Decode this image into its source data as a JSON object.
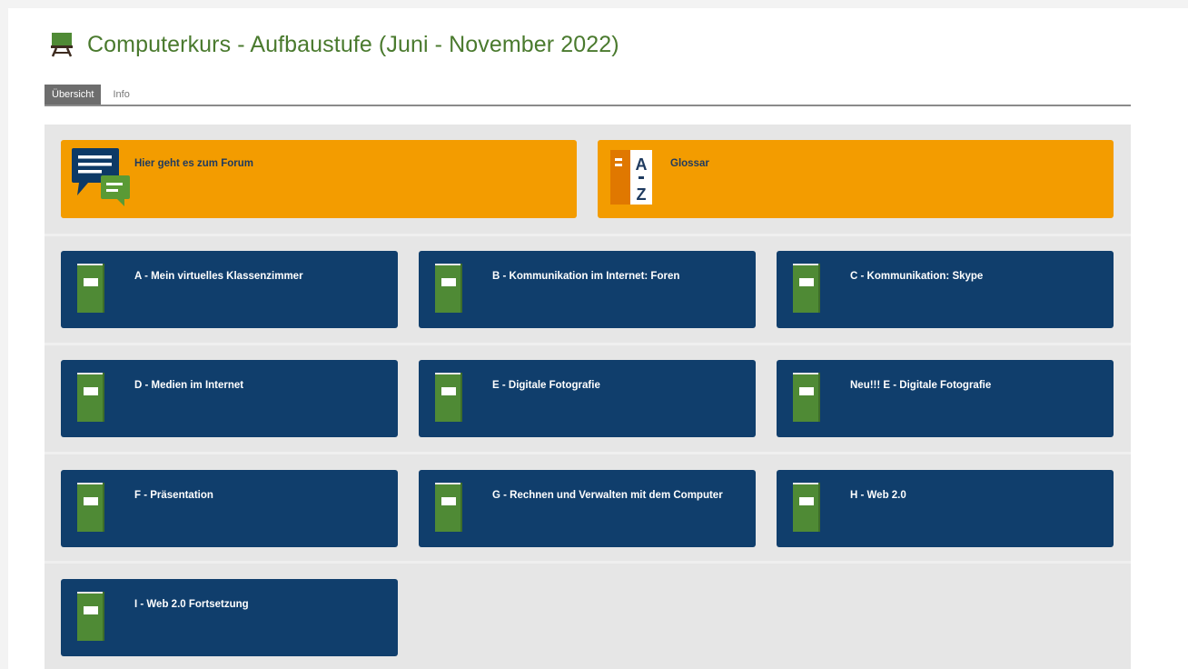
{
  "course": {
    "title": "Computerkurs - Aufbaustufe (Juni - November 2022)",
    "title_color": "#4a7a2e",
    "icon": "course-easel-icon"
  },
  "tabs": [
    {
      "label": "Übersicht",
      "active": true
    },
    {
      "label": "Info",
      "active": false
    }
  ],
  "featured": [
    {
      "label": "Hier geht es zum Forum",
      "icon": "forum-chat-icon",
      "color": "#f39c00"
    },
    {
      "label": "Glossar",
      "icon": "glossary-az-icon",
      "color": "#f39c00"
    }
  ],
  "modules": [
    {
      "label": "A - Mein virtuelles Klassenzimmer",
      "icon": "book-icon"
    },
    {
      "label": "B - Kommunikation im Internet: Foren",
      "icon": "book-icon"
    },
    {
      "label": "C - Kommunikation: Skype",
      "icon": "book-icon"
    },
    {
      "label": "D - Medien im Internet",
      "icon": "book-icon"
    },
    {
      "label": "E - Digitale Fotografie",
      "icon": "book-icon"
    },
    {
      "label": "Neu!!! E - Digitale Fotografie",
      "icon": "book-icon"
    },
    {
      "label": "F - Präsentation",
      "icon": "book-icon"
    },
    {
      "label": "G - Rechnen und Verwalten mit dem Computer",
      "icon": "book-icon"
    },
    {
      "label": "H - Web 2.0",
      "icon": "book-icon"
    },
    {
      "label": "I - Web 2.0 Fortsetzung",
      "icon": "book-icon"
    }
  ],
  "colors": {
    "module_tile": "#103e6c",
    "featured_tile": "#f39c00",
    "book_green": "#4f8a35"
  }
}
